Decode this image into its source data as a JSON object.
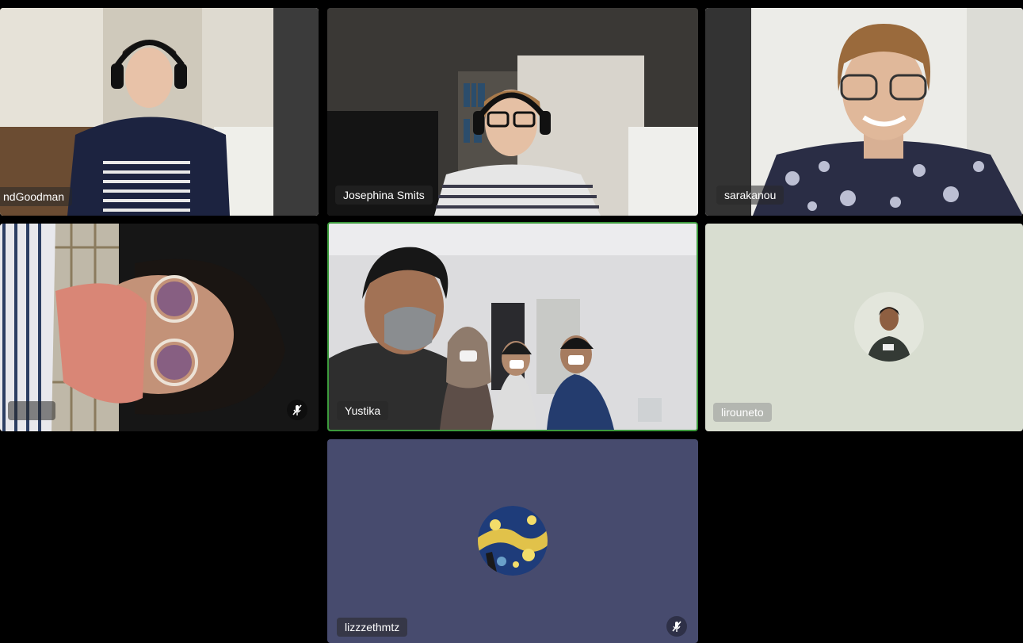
{
  "participants": [
    {
      "name": "ndGoodman",
      "muted": false
    },
    {
      "name": "Josephina Smits",
      "muted": false
    },
    {
      "name": "sarakanou",
      "muted": false
    },
    {
      "name": "",
      "muted": true
    },
    {
      "name": "Yustika",
      "muted": false,
      "active_speaker": true
    },
    {
      "name": "lirouneto",
      "muted": false
    },
    {
      "name": "lizzzethmtz",
      "muted": true
    }
  ],
  "colors": {
    "background": "#000000",
    "active_border": "#3c9a3c",
    "avatar_tile_light": "#d8ddd0",
    "avatar_tile_dark": "#474b6e"
  },
  "icons": {
    "muted": "microphone-muted-icon"
  }
}
